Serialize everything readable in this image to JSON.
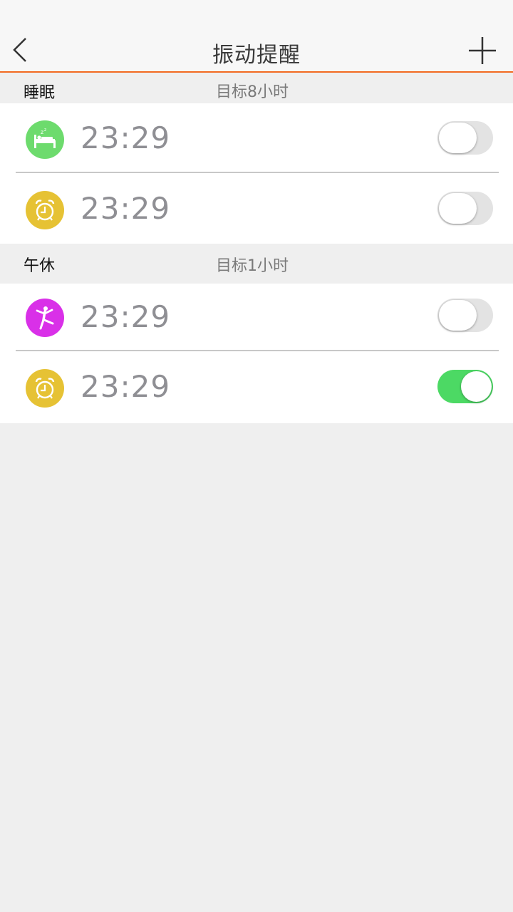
{
  "header": {
    "title": "振动提醒",
    "accent_color": "#f26a21"
  },
  "sections": [
    {
      "name": "睡眠",
      "goal": "目标8小时",
      "items": [
        {
          "icon": "bed-sleep-icon",
          "icon_color": "#6ddb6d",
          "time": "23:29",
          "enabled": false
        },
        {
          "icon": "alarm-clock-icon",
          "icon_color": "#e6c234",
          "time": "23:29",
          "enabled": false
        }
      ]
    },
    {
      "name": "午休",
      "goal": "目标1小时",
      "items": [
        {
          "icon": "stretching-person-icon",
          "icon_color": "#d930e8",
          "time": "23:29",
          "enabled": false
        },
        {
          "icon": "alarm-clock-icon",
          "icon_color": "#e6c234",
          "time": "23:29",
          "enabled": true
        }
      ]
    }
  ]
}
